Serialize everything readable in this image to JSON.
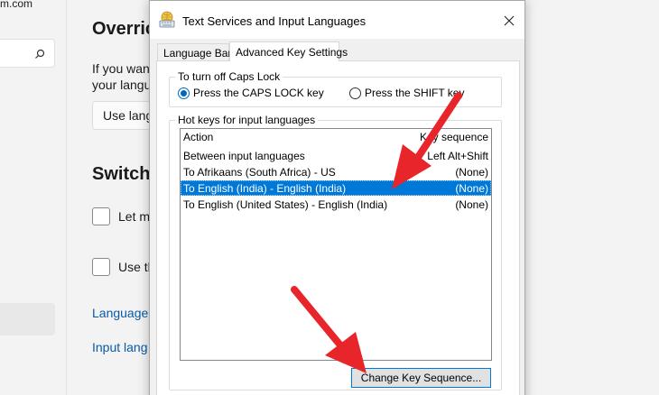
{
  "background": {
    "top_fragment": "m.com",
    "heading_override": "Overric",
    "text_line1": "If you wan",
    "text_line2": "your langu",
    "select_value": "Use lang",
    "heading_switching": "Switchi",
    "checkbox1_label": "Let m",
    "checkbox2_label": "Use th",
    "link1": "Language",
    "link2": "Input lang"
  },
  "dialog": {
    "title": "Text Services and Input Languages",
    "tabs": [
      {
        "label": "Language Bar",
        "active": false
      },
      {
        "label": "Advanced Key Settings",
        "active": true
      }
    ],
    "caps_group": {
      "title": "To turn off Caps Lock",
      "options": [
        {
          "label": "Press the CAPS LOCK key",
          "checked": true
        },
        {
          "label": "Press the SHIFT key",
          "checked": false
        }
      ]
    },
    "hotkeys_group": {
      "title": "Hot keys for input languages",
      "columns": [
        "Action",
        "Key sequence"
      ],
      "rows": [
        {
          "action": "Between input languages",
          "key": "Left Alt+Shift",
          "selected": false
        },
        {
          "action": "To Afrikaans (South Africa) - US",
          "key": "(None)",
          "selected": false
        },
        {
          "action": "To English (India) - English (India)",
          "key": "(None)",
          "selected": true
        },
        {
          "action": "To English (United States) - English (India)",
          "key": "(None)",
          "selected": false
        }
      ]
    },
    "change_button": "Change Key Sequence..."
  },
  "colors": {
    "selection": "#0078d7",
    "arrow": "#e8252a",
    "link": "#0a5aa5"
  },
  "icons": [
    "search-icon",
    "keyboard-globe-icon",
    "close-icon",
    "red-arrow-icon"
  ]
}
